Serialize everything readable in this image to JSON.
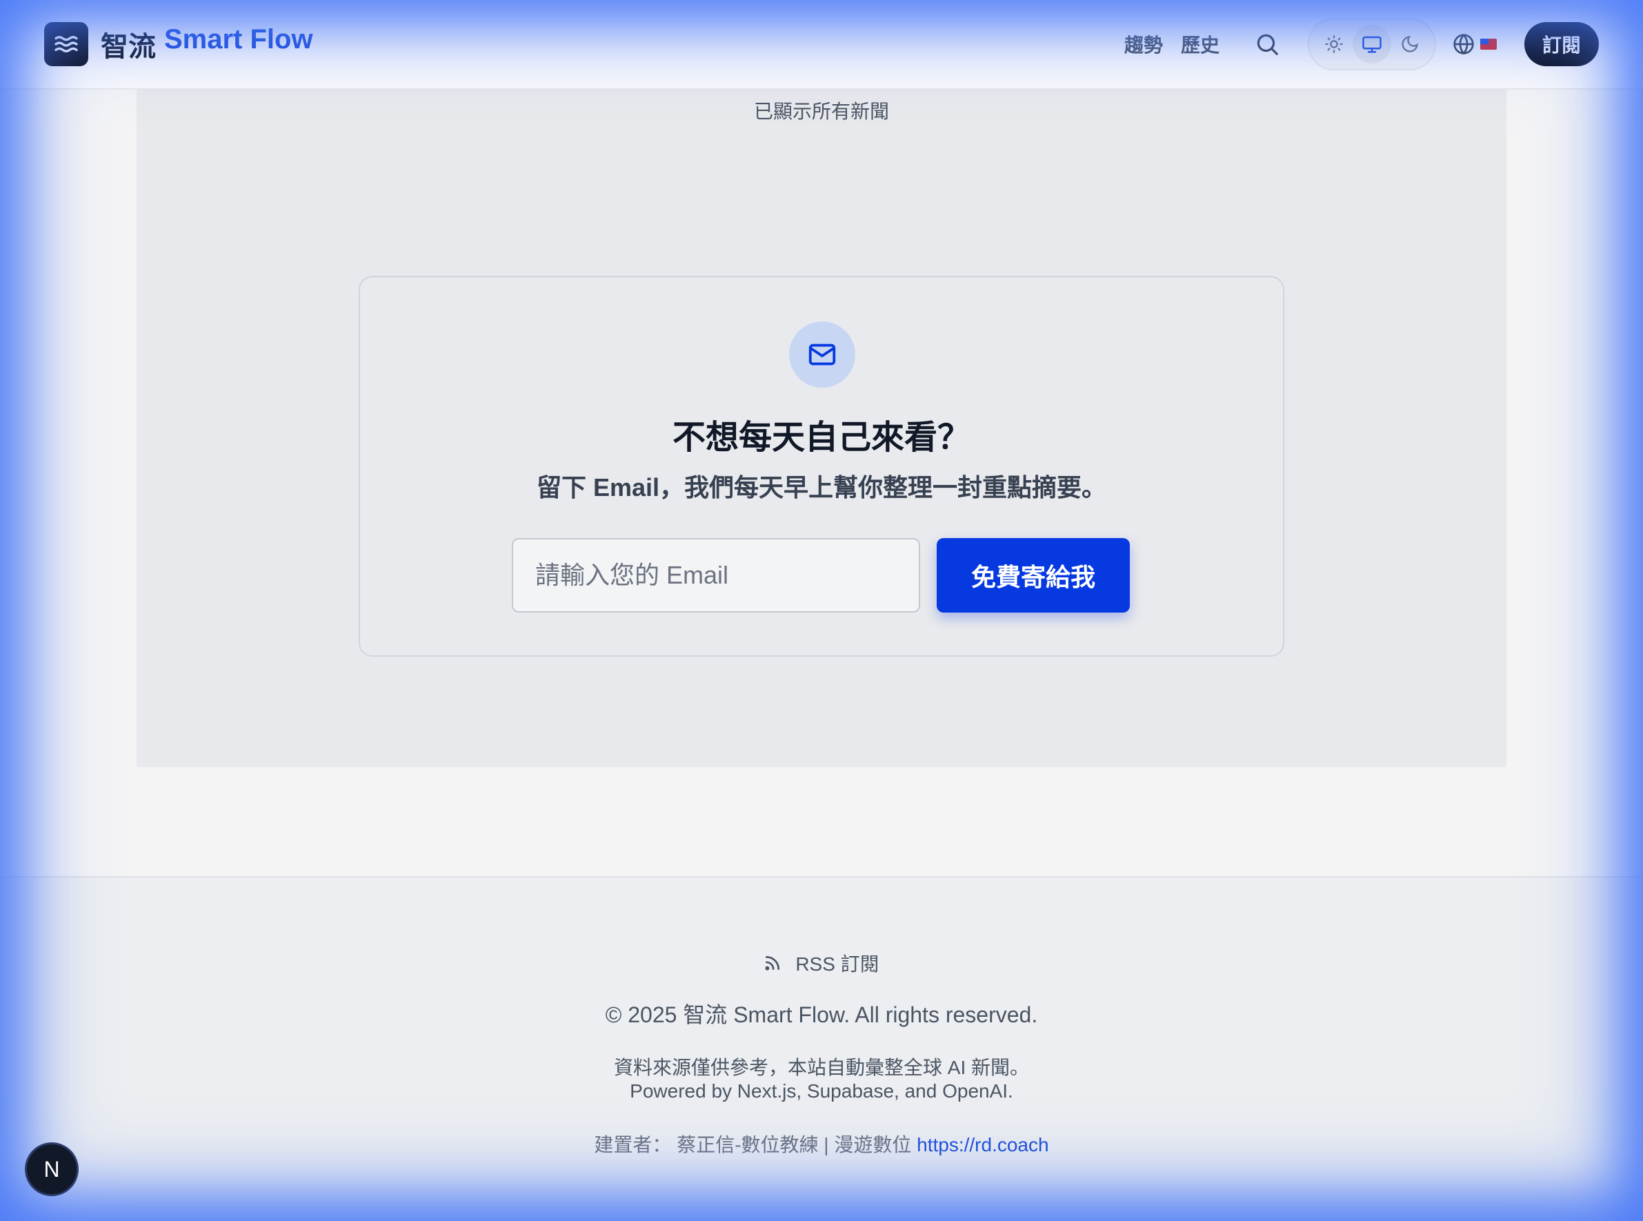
{
  "header": {
    "brand_cn": "智流",
    "brand_en": "Smart Flow",
    "nav": [
      "趨勢",
      "歷史"
    ],
    "subscribe_label": "訂閱"
  },
  "main": {
    "all_shown_text": "已顯示所有新聞"
  },
  "newsletter": {
    "title": "不想每天自己來看？",
    "subtitle": "留下 Email，我們每天早上幫你整理一封重點摘要。",
    "email_placeholder": "請輸入您的 Email",
    "email_value": "",
    "button_label": "免費寄給我"
  },
  "footer": {
    "rss_label": "RSS 訂閱",
    "copyright": "© 2025 智流 Smart Flow. All rights reserved.",
    "note_line1": "資料來源僅供參考，本站自動彙整全球 AI 新聞。",
    "note_line2": "Powered by Next.js, Supabase, and OpenAI.",
    "builder_prefix": "建置者： 蔡正信-數位教練 | 漫遊數位 ",
    "builder_link": "https://rd.coach"
  },
  "badge": {
    "label": "N"
  },
  "colors": {
    "brand_blue": "#1d4ed8",
    "cta_blue": "#0739e0",
    "dark": "#0b1020",
    "glow_blue": "#3b6ef6"
  },
  "icons": {
    "logo": "waves-icon",
    "search": "search-icon",
    "theme_light": "sun-icon",
    "theme_system": "monitor-icon",
    "theme_dark": "moon-icon",
    "language": "globe-icon",
    "flag": "flag-icon",
    "mail": "mail-icon",
    "rss": "rss-icon"
  }
}
